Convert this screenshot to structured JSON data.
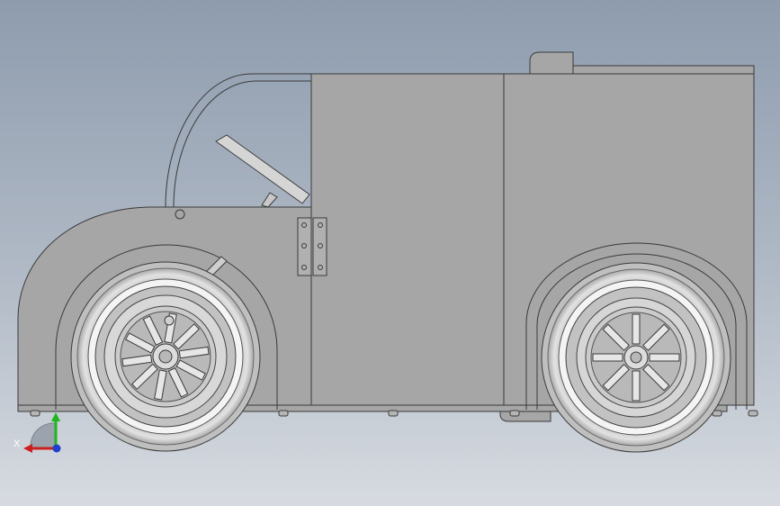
{
  "viewport": {
    "background_top": "#8e9cae",
    "background_bottom": "#d7dbe1"
  },
  "model": {
    "body_fill": "#a6a6a6",
    "edge_color": "#3a3a3a",
    "tire_fill": "#c4c4c4",
    "rim_fill": "#dcdcdc"
  },
  "triad": {
    "x_label": "X",
    "y_label": "Y",
    "x_color": "#cc1f1f",
    "y_color": "#1fb61f",
    "z_color": "#1f3fcc"
  }
}
